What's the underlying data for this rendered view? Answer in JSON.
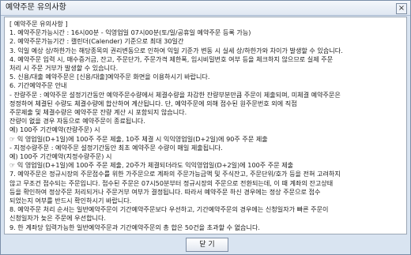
{
  "window": {
    "title": "예약주문 유의사항",
    "close_label": "×"
  },
  "notice": {
    "lines": [
      "[ 예약주문 유의사항 ]",
      "1. 예약주문가능시간 : 16시00분 - 익영업일 07시00분(토/일/공휴일 예약주문 등록 가능)",
      "2. 예약주문가능기간 : 캘린더(Calender) 기준으로 최대 30일간",
      "3. 익일 예상 상/하한가는 해당종목의 권리변동으로 인하여 익일 기준가 변동 시 실세 상/하한가와 차이가 발생할 수 있습니다.",
      "4. 예약주문 입력 시, 매수증거금, 잔고, 주문단가, 주문가격 제한폭, 임시비밀번호 여부 등을 체크하지 않으므로 실제 주문",
      "   처리 시 주문 거부가 발생할 수 있습니다.",
      "5. 신용/대출 예약주문은 [신용/대출]예약주문 화면을 이용하시기 바랍니다.",
      "6. 기간예약주문 안내",
      "  - 잔량주문 : 예약주문 설정기간동안 예약주문수량에서 체결수량을 차감한 잔량부분만큼 주문이 제출되며, 미체결 예약주문은",
      "                 정정하여 체결된 수량도 체결수량에 합산하여 계산됩니다. 단, 예약주문에 의해 접수된 원주문번호 외에 직접",
      "                 주문제출 및 체결수량은 예약주문 잔량 계산 시 포함되지 않습니다.",
      "                 잔량이 없을 경우 자동으로 예약주문이 종료됩니다.",
      "     예) 100주 기간예약(잔량주문) 시",
      "          ☞ 익 영업일(D+1일)에 100주 주문 제출, 10주 체결 시 익익영업일(D+2일)에 90주 주문 제출",
      "  - 지정수량주문 : 예약주문 설정기간동안 최초 예약주문 수량이 매일 제출됩니다.",
      "     예) 100주 기간예약(지정수량주문) 시",
      "          ☞ 익 영업일(D+1일)에 100주 주문 제출, 20주가 체결되더라도 익익영업일(D+2일)에 100주 주문 제출",
      "7. 예약주문은 정규시장의 주문접수를 위한 가주문으로 계좌의 주문가능금액 및 주식잔고, 주문단위/호가 등을 전혀 고려하지",
      "   않고 무조건 접수되는 주문입니다. 접수된 주문은 07시50분부터 정규시장의 주문으로 전환되는데, 이 때 계좌의 잔고상태",
      "   등을 확인하여 정상주문 처리되거나 주문거부 여부가 결정됩니다. 따라서 예약주문 하신 경우에는 정상 주문으로 접수",
      "   되었는지 여부를 반드시 확인하시기 바랍니다.",
      "8. 예약주문 처리 순서는 일반예약주문이 기간예약주문보다 우선하고, 기간예약주문의 경우에는 신청일자가 빠른 주문이",
      "   신청일자가 늦은 주문에 우선합니다.",
      "9. 한 계좌당 입력가능한 일반예약주문과 기간예약주문의 총 합은 50건을 초과할 수 없습니다."
    ]
  },
  "footer": {
    "close_button_label": "닫 기"
  }
}
